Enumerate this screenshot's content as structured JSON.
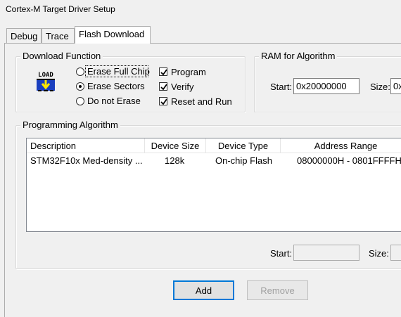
{
  "window": {
    "title": "Cortex-M Target Driver Setup"
  },
  "tabs": [
    {
      "label": "Debug"
    },
    {
      "label": "Trace"
    },
    {
      "label": "Flash Download",
      "active": true
    }
  ],
  "download_function": {
    "title": "Download Function",
    "icon_text": "LOAD",
    "erase_options": [
      {
        "label": "Erase Full Chip",
        "selected": false
      },
      {
        "label": "Erase Sectors",
        "selected": true
      },
      {
        "label": "Do not Erase",
        "selected": false
      }
    ],
    "checks": [
      {
        "label": "Program",
        "checked": true
      },
      {
        "label": "Verify",
        "checked": true
      },
      {
        "label": "Reset and Run",
        "checked": true
      }
    ]
  },
  "ram_for_algorithm": {
    "title": "RAM for Algorithm",
    "start_label": "Start:",
    "start_value": "0x20000000",
    "size_label": "Size:",
    "size_value": "0x"
  },
  "programming_algorithm": {
    "title": "Programming Algorithm",
    "columns": [
      "Description",
      "Device Size",
      "Device Type",
      "Address Range"
    ],
    "rows": [
      {
        "description": "STM32F10x Med-density ...",
        "device_size": "128k",
        "device_type": "On-chip Flash",
        "address_range": "08000000H - 0801FFFFH"
      }
    ],
    "start_label": "Start:",
    "start_value": "",
    "size_label": "Size:",
    "size_value": ""
  },
  "buttons": {
    "add": "Add",
    "remove": "Remove"
  },
  "colors": {
    "background": "#f0f0f0",
    "accent": "#0078d7",
    "load_icon": "#1a3fbf"
  }
}
